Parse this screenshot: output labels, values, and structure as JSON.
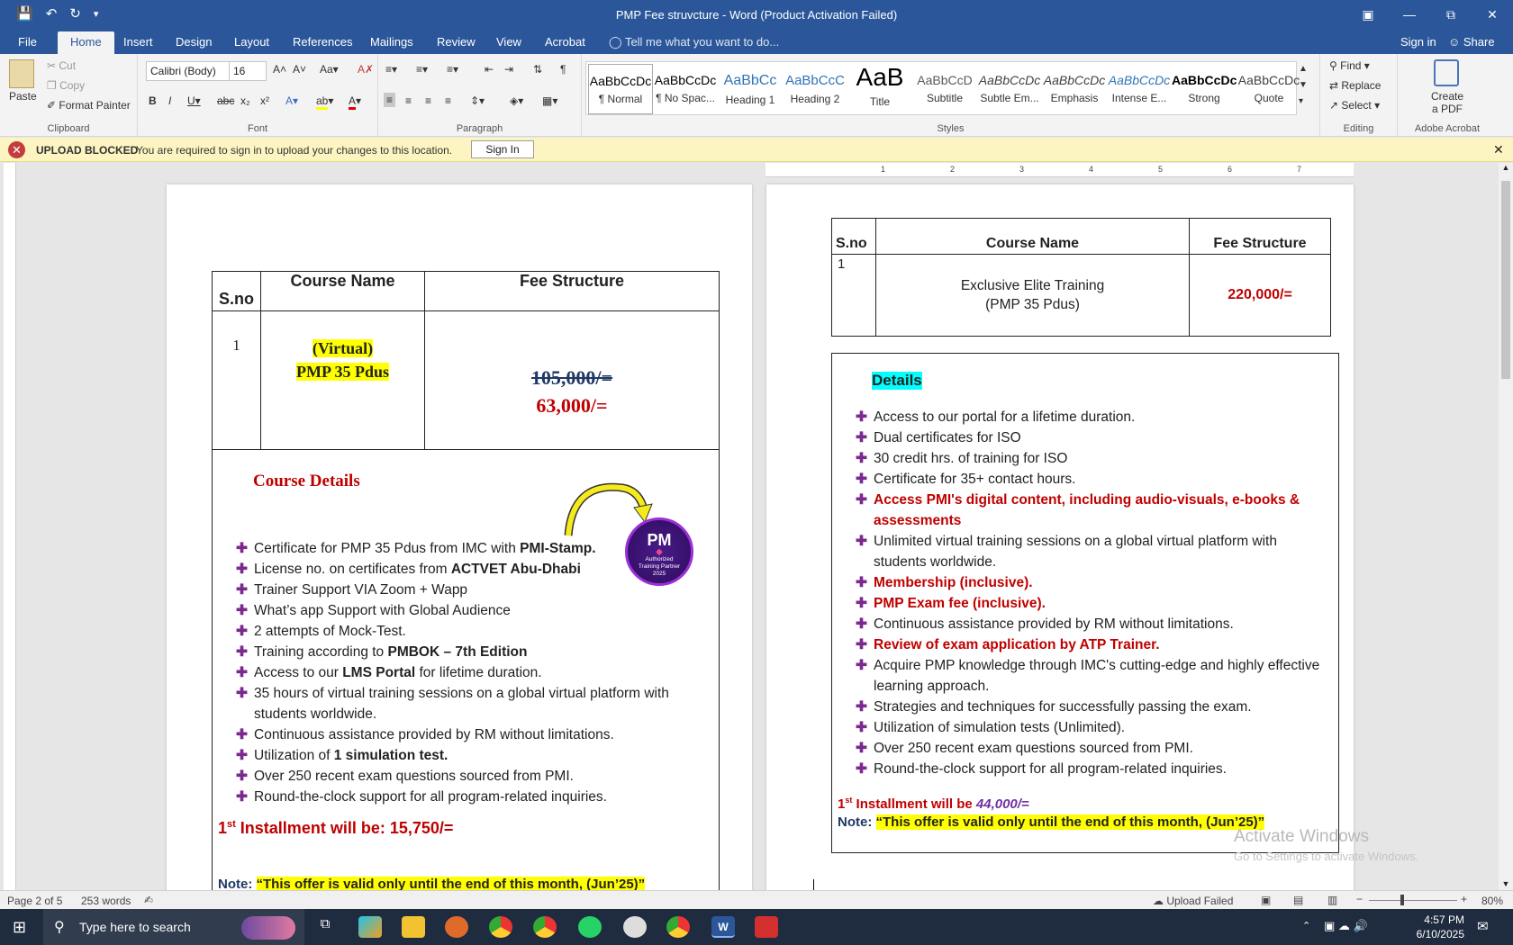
{
  "titlebar": {
    "title": "PMP Fee struvcture - Word (Product Activation Failed)",
    "undo_icon": "undo-icon",
    "redo_icon": "redo-icon"
  },
  "tabs": [
    "File",
    "Home",
    "Insert",
    "Design",
    "Layout",
    "References",
    "Mailings",
    "Review",
    "View",
    "Acrobat"
  ],
  "tell_me": "Tell me what you want to do...",
  "sign_in": "Sign in",
  "share": "Share",
  "ribbon": {
    "clipboard": {
      "paste": "Paste",
      "cut": "Cut",
      "copy": "Copy",
      "format_painter": "Format Painter",
      "label": "Clipboard"
    },
    "font": {
      "name": "Calibri (Body)",
      "size": "16",
      "label": "Font"
    },
    "paragraph": {
      "label": "Paragraph"
    },
    "styles": {
      "label": "Styles",
      "items": [
        {
          "preview": "AaBbCcDc",
          "name": "¶ Normal"
        },
        {
          "preview": "AaBbCcDc",
          "name": "¶ No Spac..."
        },
        {
          "preview": "AaBbCc",
          "name": "Heading 1"
        },
        {
          "preview": "AaBbCcC",
          "name": "Heading 2"
        },
        {
          "preview": "AaB",
          "name": "Title"
        },
        {
          "preview": "AaBbCcD",
          "name": "Subtitle"
        },
        {
          "preview": "AaBbCcDc",
          "name": "Subtle Em..."
        },
        {
          "preview": "AaBbCcDc",
          "name": "Emphasis"
        },
        {
          "preview": "AaBbCcDc",
          "name": "Intense E..."
        },
        {
          "preview": "AaBbCcDc",
          "name": "Strong"
        },
        {
          "preview": "AaBbCcDc",
          "name": "Quote"
        }
      ]
    },
    "editing": {
      "find": "Find",
      "replace": "Replace",
      "select": "Select",
      "label": "Editing"
    },
    "acrobat": {
      "create": "Create",
      "pdf": "a PDF",
      "label": "Adobe Acrobat"
    }
  },
  "message_bar": {
    "label": "UPLOAD BLOCKED",
    "text": "You are required to sign in to upload your changes to this location.",
    "button": "Sign In"
  },
  "ruler_numbers": [
    "1",
    "2",
    "3",
    "4",
    "5",
    "6",
    "7"
  ],
  "page1": {
    "headers": {
      "sno": "S.no",
      "course": "Course Name",
      "fee": "Fee Structure"
    },
    "row": {
      "sno": "1",
      "course_line1": "(Virtual)",
      "course_line2": "PMP 35 Pdus",
      "old_fee": "105,000/=",
      "new_fee": "63,000/="
    },
    "details_title": "Course Details",
    "badge": {
      "line1": "Authorized",
      "line2": "Training Partner",
      "line3": "2025"
    },
    "bullets": [
      {
        "pre": "Certificate for PMP 35 Pdus from IMC with ",
        "bold": "PMI-Stamp.",
        "post": ""
      },
      {
        "pre": "License no. on certificates from ",
        "bold": "ACTVET Abu-Dhabi",
        "post": ""
      },
      {
        "pre": "Trainer Support VIA Zoom + Wapp",
        "bold": "",
        "post": ""
      },
      {
        "pre": "What’s app Support with Global Audience",
        "bold": "",
        "post": ""
      },
      {
        "pre": "2 attempts of Mock-Test.",
        "bold": "",
        "post": ""
      },
      {
        "pre": "Training according to ",
        "bold": "PMBOK – 7th Edition",
        "post": ""
      },
      {
        "pre": "Access to our ",
        "bold": "LMS Portal",
        "post": " for lifetime duration."
      },
      {
        "pre": "35 hours of virtual training sessions on a global virtual platform with students worldwide.",
        "bold": "",
        "post": ""
      },
      {
        "pre": "Continuous assistance provided by RM without limitations.",
        "bold": "",
        "post": ""
      },
      {
        "pre": "Utilization of ",
        "bold": "1 simulation test.",
        "post": ""
      },
      {
        "pre": "Over 250 recent exam questions sourced from PMI.",
        "bold": "",
        "post": ""
      },
      {
        "pre": "Round-the-clock support for all program-related inquiries.",
        "bold": "",
        "post": ""
      }
    ],
    "installment_pre": "1",
    "installment_sup": "st",
    "installment_text": " Installment will be: 15,750/=",
    "note_label": "Note: ",
    "note_text": "“This offer is valid only until the end of this month, (Jun’25)”"
  },
  "page2": {
    "headers": {
      "sno": "S.no",
      "course": "Course Name",
      "fee": "Fee Structure"
    },
    "row": {
      "sno": "1",
      "course_line1": "Exclusive Elite Training",
      "course_line2": "(PMP 35 Pdus)",
      "fee": "220,000/="
    },
    "details_title": "Details",
    "bullets": [
      {
        "text": "Access to our portal for a lifetime duration.",
        "style": "normal"
      },
      {
        "text": "Dual certificates for ISO",
        "style": "normal"
      },
      {
        "text": "30 credit hrs. of training for ISO",
        "style": "normal"
      },
      {
        "text": "Certificate for 35+ contact hours.",
        "style": "normal"
      },
      {
        "text": "Access PMI's digital content, including audio-visuals, e-books & assessments",
        "style": "red"
      },
      {
        "text": "Unlimited virtual training sessions on a global virtual platform with students worldwide.",
        "style": "normal"
      },
      {
        "text": "Membership (inclusive).",
        "style": "red"
      },
      {
        "text": "PMP Exam fee (inclusive).",
        "style": "red"
      },
      {
        "text": "Continuous assistance provided by RM without limitations.",
        "style": "normal"
      },
      {
        "text": " Review of exam application by ATP Trainer.",
        "style": "red"
      },
      {
        "text": "Acquire PMP knowledge through IMC's cutting-edge and highly effective learning approach.",
        "style": "normal"
      },
      {
        "text": "Strategies and techniques for successfully passing the exam.",
        "style": "normal"
      },
      {
        "text": "Utilization of simulation tests (Unlimited).",
        "style": "normal"
      },
      {
        "text": "Over 250 recent exam questions sourced from PMI.",
        "style": "normal"
      },
      {
        "text": "Round-the-clock support for all program-related inquiries.",
        "style": "normal"
      }
    ],
    "installment_pre": "1",
    "installment_sup": "st",
    "installment_text": " Installment will be ",
    "installment_value": "44,000/=",
    "note_label": "Note: ",
    "note_text": "“This offer is valid only until the end of this month, (Jun’25)”"
  },
  "watermark": {
    "line1": "Activate Windows",
    "line2": "Go to Settings to activate Windows."
  },
  "status": {
    "page": "Page 2 of 5",
    "words": "253 words",
    "upload": "Upload Failed",
    "zoom": "80%"
  },
  "taskbar": {
    "search_placeholder": "Type here to search",
    "time": "4:57 PM",
    "date": "6/10/2025"
  }
}
